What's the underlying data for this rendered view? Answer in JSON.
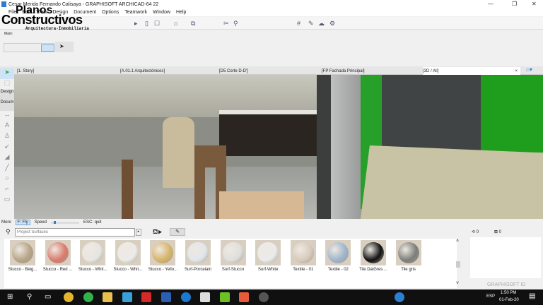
{
  "window": {
    "title": "Cesar Merida Fernando Calisaya - GRAPHISOFT ARCHICAD-64 22",
    "minimize": "—",
    "restore": "❐",
    "close": "✕"
  },
  "watermark": {
    "line1": "Planos",
    "line2": "Constructivos",
    "line3": "Arquitectura-Inmobiliaria"
  },
  "menu": [
    "File",
    "Edit",
    "View",
    "Design",
    "Document",
    "Options",
    "Teamwork",
    "Window",
    "Help"
  ],
  "palette": {
    "label": "Main:"
  },
  "tabs": [
    {
      "label": "[1. Story]"
    },
    {
      "label": "[A.01.1 Arquitectónicos]"
    },
    {
      "label": "[D5 Corte D-D']"
    },
    {
      "label": "[FP Fachada Principal]"
    },
    {
      "label": "[3D / All]",
      "close": "×"
    }
  ],
  "toolbox": {
    "design": "Design",
    "document": "Docum",
    "more": "More"
  },
  "flybar": {
    "mode": "F: Fly",
    "speed": "Speed",
    "quit": "ESC: quit"
  },
  "surfaces": {
    "search_placeholder": "Project Surfaces",
    "items": [
      {
        "label": "Stucco - Beig...",
        "color": "#b7a487"
      },
      {
        "label": "Stucco - Red ...",
        "color": "#d97a6c"
      },
      {
        "label": "Stucco - Whit...",
        "color": "#e8e6e2"
      },
      {
        "label": "Stucco - Whit...",
        "color": "#ecebe8"
      },
      {
        "label": "Stucco - Yello...",
        "color": "#d7b46a"
      },
      {
        "label": "Surf-Porcelain",
        "color": "#e2e6ea"
      },
      {
        "label": "Surf-Stucco",
        "color": "#e0dfdb"
      },
      {
        "label": "Surf-White",
        "color": "#ebebeb"
      },
      {
        "label": "Textile - 01",
        "color": "#d8cbbd"
      },
      {
        "label": "Textile - 02",
        "color": "#9fb4cc"
      },
      {
        "label": "Tile DalGres ...",
        "color": "#111111"
      },
      {
        "label": "Tile gris",
        "color": "#7d7d7a"
      }
    ],
    "count_a": "0",
    "count_b": "0",
    "id_label": "GRAPHISOFT ID"
  },
  "tray": {
    "lang": "ESP",
    "time": "1:50 PM",
    "date": "01-Feb-20"
  }
}
